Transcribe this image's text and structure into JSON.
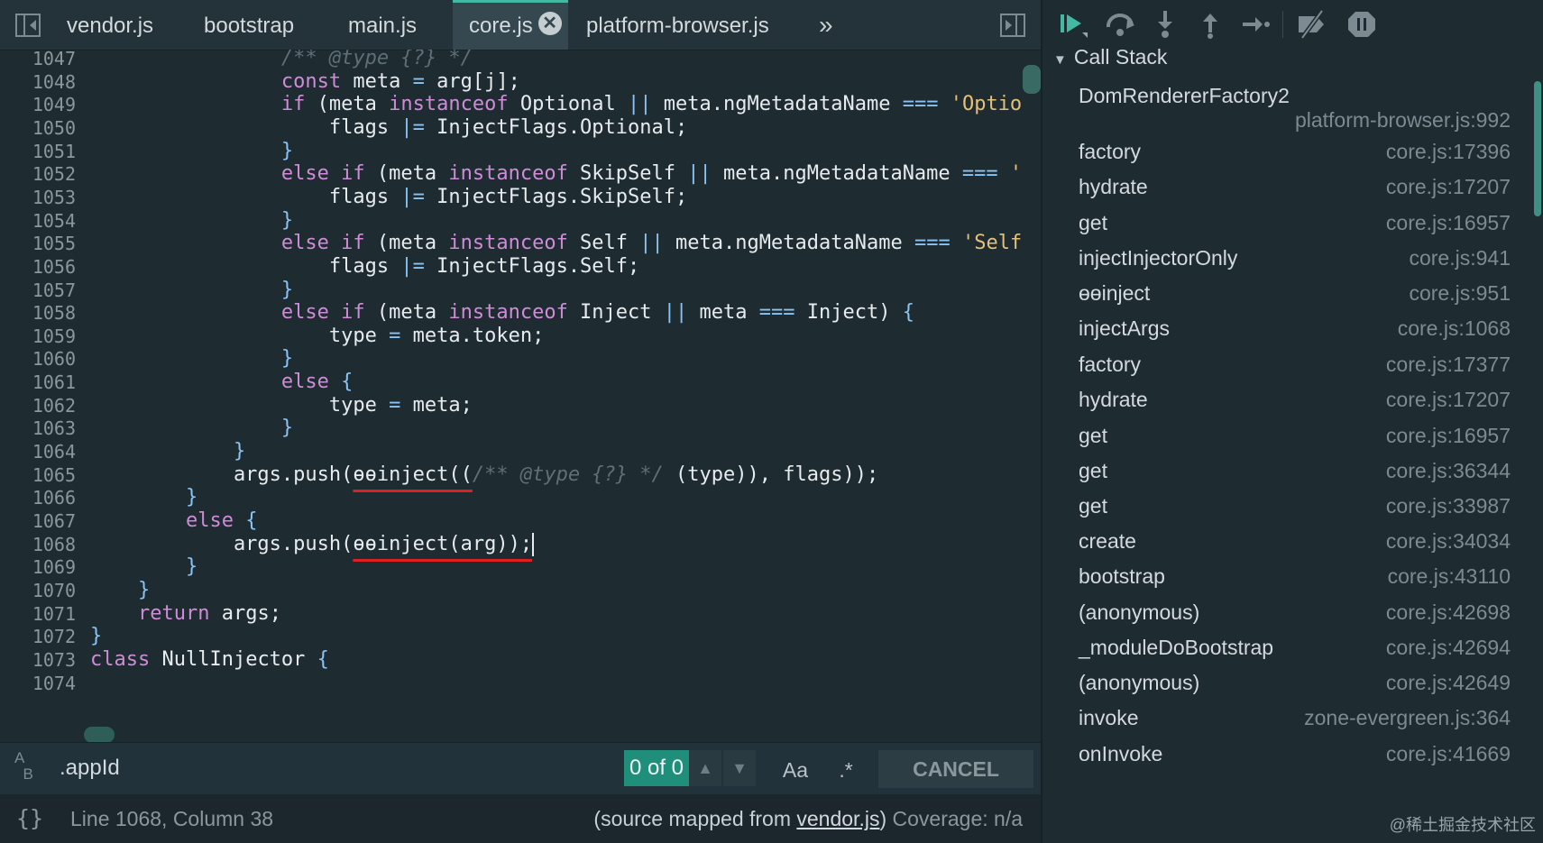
{
  "tabs": [
    {
      "label": "vendor.js",
      "active": false
    },
    {
      "label": "bootstrap",
      "active": false
    },
    {
      "label": "main.js",
      "active": false
    },
    {
      "label": "core.js",
      "active": true
    },
    {
      "label": "platform-browser.js",
      "active": false
    }
  ],
  "icons": {
    "toggle_navigator": "sidebar-toggle-icon",
    "close_tab": "close-icon",
    "overflow": "chevron-double-right-icon",
    "toggle_debugger": "sidebar-right-toggle-icon"
  },
  "tab_close_glyph": "✕",
  "overflow_glyph": "»",
  "editor": {
    "line_numbers": [
      "1047",
      "1048",
      "1049",
      "1050",
      "1051",
      "1052",
      "1053",
      "1054",
      "1055",
      "1056",
      "1057",
      "1058",
      "1059",
      "1060",
      "1061",
      "1062",
      "1063",
      "1064",
      "1065",
      "1066",
      "1067",
      "1068",
      "1069",
      "1070",
      "1071",
      "1072",
      "1073",
      "1074"
    ],
    "code_lines": [
      [
        {
          "t": "                ",
          "c": "pn"
        },
        {
          "t": "/** @type {?} */",
          "c": "cm"
        }
      ],
      [
        {
          "t": "                ",
          "c": "pn"
        },
        {
          "t": "const",
          "c": "kw"
        },
        {
          "t": " meta ",
          "c": "pn"
        },
        {
          "t": "=",
          "c": "op"
        },
        {
          "t": " arg[j];",
          "c": "pn"
        }
      ],
      [
        {
          "t": "                ",
          "c": "pn"
        },
        {
          "t": "if",
          "c": "kw"
        },
        {
          "t": " (meta ",
          "c": "pn"
        },
        {
          "t": "instanceof",
          "c": "kw"
        },
        {
          "t": " Optional ",
          "c": "pn"
        },
        {
          "t": "||",
          "c": "op"
        },
        {
          "t": " meta.ngMetadataName ",
          "c": "pn"
        },
        {
          "t": "===",
          "c": "op"
        },
        {
          "t": " ",
          "c": "pn"
        },
        {
          "t": "'Option",
          "c": "st"
        }
      ],
      [
        {
          "t": "                    flags ",
          "c": "pn"
        },
        {
          "t": "|=",
          "c": "op"
        },
        {
          "t": " InjectFlags.Optional;",
          "c": "pn"
        }
      ],
      [
        {
          "t": "                }",
          "c": "op"
        }
      ],
      [
        {
          "t": "                ",
          "c": "pn"
        },
        {
          "t": "else if",
          "c": "kw"
        },
        {
          "t": " (meta ",
          "c": "pn"
        },
        {
          "t": "instanceof",
          "c": "kw"
        },
        {
          "t": " SkipSelf ",
          "c": "pn"
        },
        {
          "t": "||",
          "c": "op"
        },
        {
          "t": " meta.ngMetadataName ",
          "c": "pn"
        },
        {
          "t": "===",
          "c": "op"
        },
        {
          "t": " ",
          "c": "pn"
        },
        {
          "t": "'S",
          "c": "st"
        }
      ],
      [
        {
          "t": "                    flags ",
          "c": "pn"
        },
        {
          "t": "|=",
          "c": "op"
        },
        {
          "t": " InjectFlags.SkipSelf;",
          "c": "pn"
        }
      ],
      [
        {
          "t": "                }",
          "c": "op"
        }
      ],
      [
        {
          "t": "                ",
          "c": "pn"
        },
        {
          "t": "else if",
          "c": "kw"
        },
        {
          "t": " (meta ",
          "c": "pn"
        },
        {
          "t": "instanceof",
          "c": "kw"
        },
        {
          "t": " Self ",
          "c": "pn"
        },
        {
          "t": "||",
          "c": "op"
        },
        {
          "t": " meta.ngMetadataName ",
          "c": "pn"
        },
        {
          "t": "===",
          "c": "op"
        },
        {
          "t": " ",
          "c": "pn"
        },
        {
          "t": "'Self'",
          "c": "st"
        }
      ],
      [
        {
          "t": "                    flags ",
          "c": "pn"
        },
        {
          "t": "|=",
          "c": "op"
        },
        {
          "t": " InjectFlags.Self;",
          "c": "pn"
        }
      ],
      [
        {
          "t": "                }",
          "c": "op"
        }
      ],
      [
        {
          "t": "                ",
          "c": "pn"
        },
        {
          "t": "else if",
          "c": "kw"
        },
        {
          "t": " (meta ",
          "c": "pn"
        },
        {
          "t": "instanceof",
          "c": "kw"
        },
        {
          "t": " Inject ",
          "c": "pn"
        },
        {
          "t": "||",
          "c": "op"
        },
        {
          "t": " meta ",
          "c": "pn"
        },
        {
          "t": "===",
          "c": "op"
        },
        {
          "t": " Inject) ",
          "c": "pn"
        },
        {
          "t": "{",
          "c": "op"
        }
      ],
      [
        {
          "t": "                    type ",
          "c": "pn"
        },
        {
          "t": "=",
          "c": "op"
        },
        {
          "t": " meta.token;",
          "c": "pn"
        }
      ],
      [
        {
          "t": "                }",
          "c": "op"
        }
      ],
      [
        {
          "t": "                ",
          "c": "pn"
        },
        {
          "t": "else",
          "c": "kw"
        },
        {
          "t": " {",
          "c": "op"
        }
      ],
      [
        {
          "t": "                    type ",
          "c": "pn"
        },
        {
          "t": "=",
          "c": "op"
        },
        {
          "t": " meta;",
          "c": "pn"
        }
      ],
      [
        {
          "t": "                }",
          "c": "op"
        }
      ],
      [
        {
          "t": "            }",
          "c": "op"
        }
      ],
      [
        {
          "t": "            args.push(",
          "c": "pn"
        },
        {
          "t": "ɵɵinject((",
          "c": "pn",
          "u": true
        },
        {
          "t": "/** @type {?} */",
          "c": "cm"
        },
        {
          "t": " (type)), flags));",
          "c": "pn"
        }
      ],
      [
        {
          "t": "        }",
          "c": "op"
        }
      ],
      [
        {
          "t": "        ",
          "c": "pn"
        },
        {
          "t": "else",
          "c": "kw"
        },
        {
          "t": " {",
          "c": "op"
        }
      ],
      [
        {
          "t": "            args.push(",
          "c": "pn"
        },
        {
          "t": "ɵɵinject(arg));",
          "c": "pn",
          "u": true
        },
        {
          "t": "",
          "c": "pn",
          "caret": true
        }
      ],
      [
        {
          "t": "        }",
          "c": "op"
        }
      ],
      [
        {
          "t": "    }",
          "c": "op"
        }
      ],
      [
        {
          "t": "    ",
          "c": "pn"
        },
        {
          "t": "return",
          "c": "kw"
        },
        {
          "t": " args;",
          "c": "pn"
        }
      ],
      [
        {
          "t": "}",
          "c": "op"
        }
      ],
      [
        {
          "t": "class",
          "c": "kw"
        },
        {
          "t": " NullInjector ",
          "c": "pn"
        },
        {
          "t": "{",
          "c": "op"
        }
      ],
      [
        {
          "t": "",
          "c": "pn"
        }
      ]
    ]
  },
  "search": {
    "value": ".appId",
    "match_count": "0 of 0",
    "match_case_label": "Aa",
    "regex_label": ".*",
    "cancel_label": "CANCEL"
  },
  "status": {
    "cursor": "Line 1068, Column 38",
    "source_map_prefix": "(source mapped from ",
    "source_map_file": "vendor.js",
    "source_map_suffix": ")",
    "coverage": "Coverage: n/a"
  },
  "debugger": {
    "callstack_title": "Call Stack",
    "frames": [
      {
        "fn": "DomRendererFactory2",
        "loc": "platform-browser.js:992"
      },
      {
        "fn": "factory",
        "loc": "core.js:17396"
      },
      {
        "fn": "hydrate",
        "loc": "core.js:17207"
      },
      {
        "fn": "get",
        "loc": "core.js:16957"
      },
      {
        "fn": "injectInjectorOnly",
        "loc": "core.js:941"
      },
      {
        "fn": "ɵɵinject",
        "loc": "core.js:951"
      },
      {
        "fn": "injectArgs",
        "loc": "core.js:1068"
      },
      {
        "fn": "factory",
        "loc": "core.js:17377"
      },
      {
        "fn": "hydrate",
        "loc": "core.js:17207"
      },
      {
        "fn": "get",
        "loc": "core.js:16957"
      },
      {
        "fn": "get",
        "loc": "core.js:36344"
      },
      {
        "fn": "get",
        "loc": "core.js:33987"
      },
      {
        "fn": "create",
        "loc": "core.js:34034"
      },
      {
        "fn": "bootstrap",
        "loc": "core.js:43110"
      },
      {
        "fn": "(anonymous)",
        "loc": "core.js:42698"
      },
      {
        "fn": "_moduleDoBootstrap",
        "loc": "core.js:42694"
      },
      {
        "fn": "(anonymous)",
        "loc": "core.js:42649"
      },
      {
        "fn": "invoke",
        "loc": "zone-evergreen.js:364"
      },
      {
        "fn": "onInvoke",
        "loc": "core.js:41669"
      }
    ]
  },
  "watermark": "@稀土掘金技术社区",
  "colors": {
    "accent": "#43b9a4",
    "match_count_bg": "#1f8f7c",
    "error_underline": "#e02020"
  }
}
